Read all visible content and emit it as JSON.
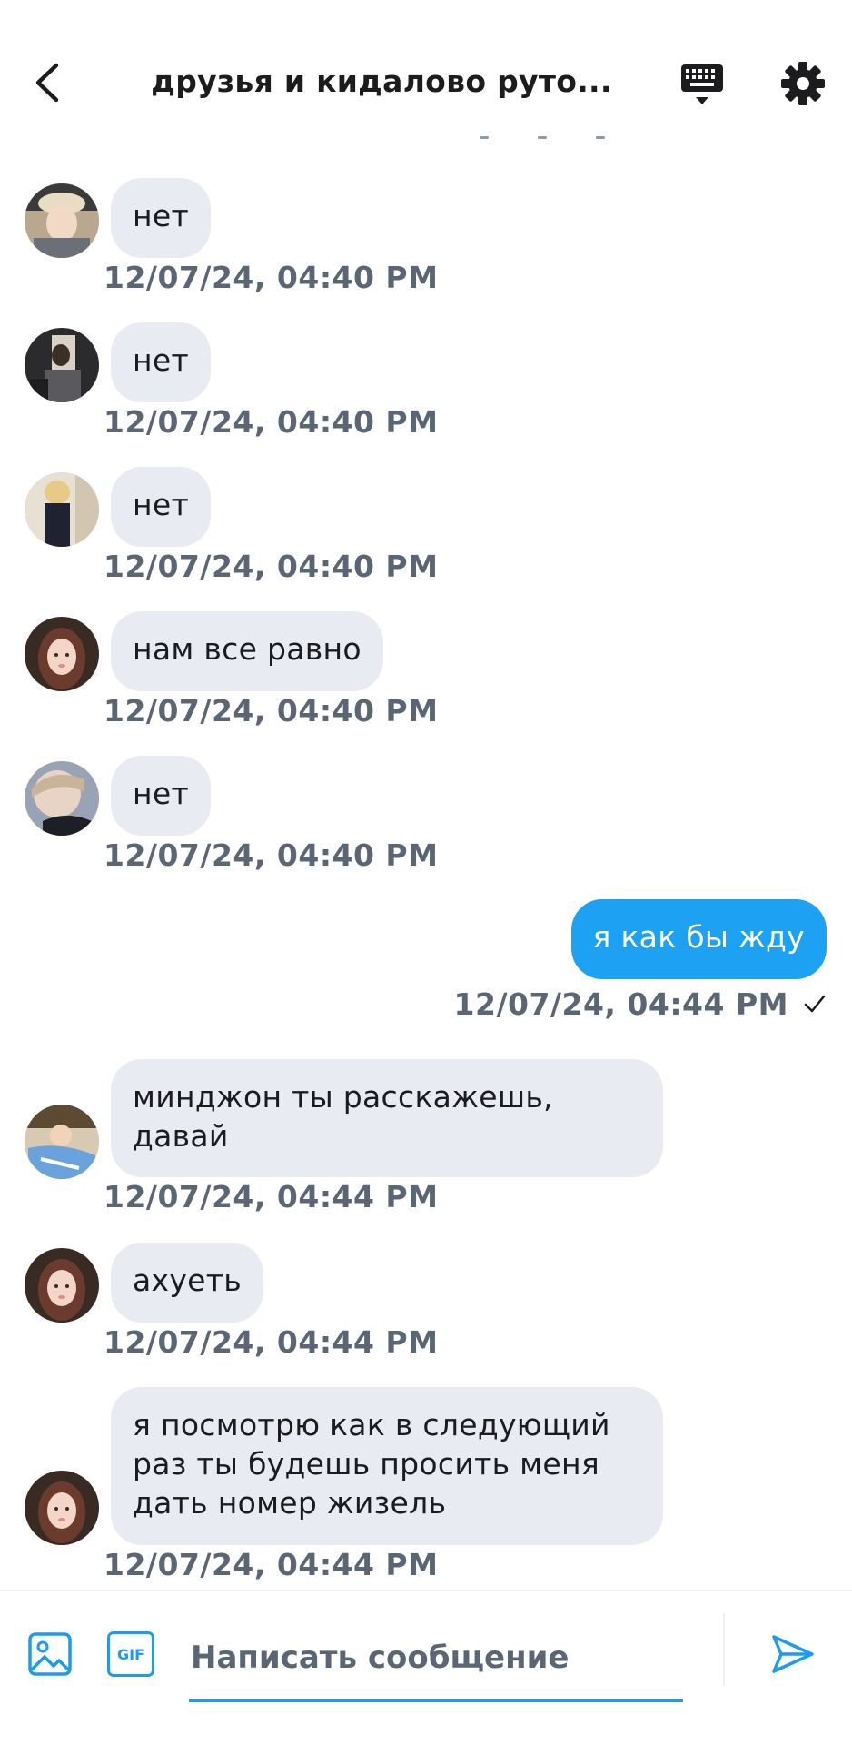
{
  "header": {
    "title": "друзья и кидалово руто...",
    "back_icon": "chevron-left-icon",
    "keyboard_icon": "keyboard-icon",
    "settings_icon": "gear-icon"
  },
  "messages": [
    {
      "text": "нет",
      "time": "12/07/24, 04:40 PM",
      "avatar": "user-avatar"
    },
    {
      "text": "нет",
      "time": "12/07/24, 04:40 PM",
      "avatar": "user-avatar"
    },
    {
      "text": "нет",
      "time": "12/07/24, 04:40 PM",
      "avatar": "user-avatar"
    },
    {
      "text": "нам все равно",
      "time": "12/07/24, 04:40 PM",
      "avatar": "user-avatar"
    },
    {
      "text": "нет",
      "time": "12/07/24, 04:40 PM",
      "avatar": "user-avatar"
    },
    {
      "text": "я как бы жду",
      "time": "12/07/24, 04:44 PM",
      "outgoing": true,
      "status": "read-check-icon"
    },
    {
      "text": "минджон ты расскажешь,\nдавай",
      "time": "12/07/24, 04:44 PM",
      "avatar": "user-avatar"
    },
    {
      "text": "ахуеть",
      "time": "12/07/24, 04:44 PM",
      "avatar": "user-avatar"
    },
    {
      "text": "я посмотрю как в следующий\nраз ты будешь просить меня\nдать номер жизель",
      "time": "12/07/24, 04:44 PM",
      "avatar": "user-avatar"
    }
  ],
  "composer": {
    "placeholder": "Написать сообщение",
    "gif_label": "GIF",
    "image_icon": "image-icon",
    "send_icon": "send-icon"
  },
  "colors": {
    "accent": "#1d9bf0",
    "outgoing_bubble": "#1da1f2",
    "incoming_bubble": "#e8ebf2",
    "timestamp": "#5b6675"
  }
}
